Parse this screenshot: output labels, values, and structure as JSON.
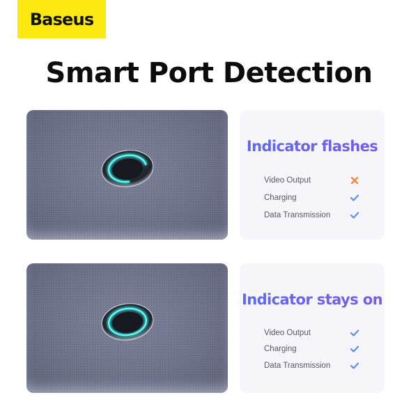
{
  "brand": {
    "logo_text": "Baseus",
    "logo_color": "#fde90f"
  },
  "page_title": "Smart Port Detection",
  "colors": {
    "accent": "#6b63e6",
    "check": "#5b8def",
    "cross": "#f0883e",
    "led": "#2ee6e0"
  },
  "panels": [
    {
      "image_alt": "Hub surface with indicator ring partially lit (flashing)",
      "indicator_state": "flashing",
      "title": "Indicator flashes",
      "rows": [
        {
          "label": "Video Output",
          "status": "unsupported",
          "icon": "cross-icon"
        },
        {
          "label": "Charging",
          "status": "supported",
          "icon": "check-icon"
        },
        {
          "label": "Data Transmission",
          "status": "supported",
          "icon": "check-icon"
        }
      ]
    },
    {
      "image_alt": "Hub surface with indicator ring fully lit (steady)",
      "indicator_state": "steady",
      "title": "Indicator stays on",
      "rows": [
        {
          "label": "Video Output",
          "status": "supported",
          "icon": "check-icon"
        },
        {
          "label": "Charging",
          "status": "supported",
          "icon": "check-icon"
        },
        {
          "label": "Data Transmission",
          "status": "supported",
          "icon": "check-icon"
        }
      ]
    }
  ]
}
